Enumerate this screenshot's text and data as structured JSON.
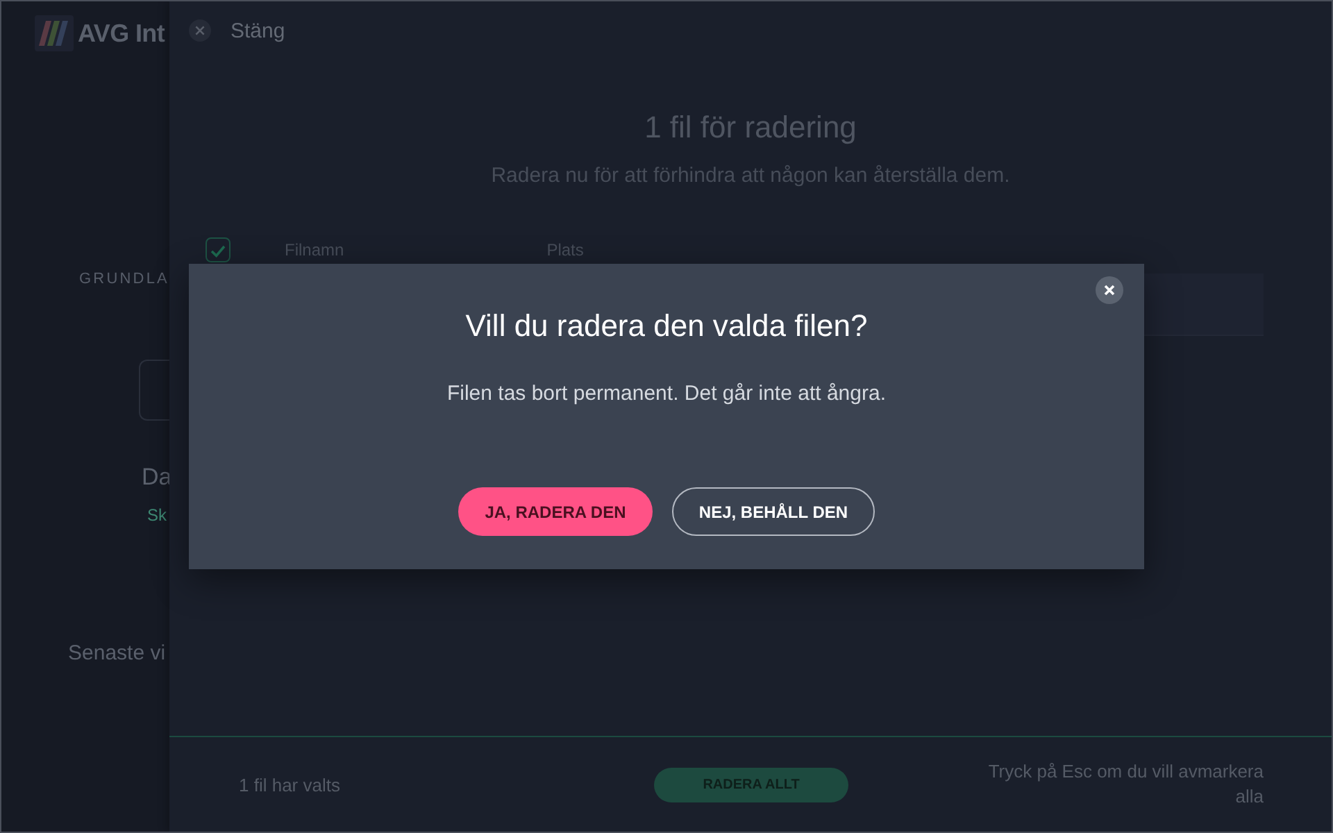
{
  "app_sidebar": {
    "logo_text": "AVG Int",
    "section_label": "GRUNDLA",
    "heading": "Da",
    "link": "Sk",
    "recent_label": "Senaste vi"
  },
  "panel": {
    "close_label": "Stäng",
    "title": "1 fil för radering",
    "subtitle": "Radera nu för att förhindra att någon kan återställa dem.",
    "table": {
      "select_all_checked": true,
      "columns": [
        "Filnamn",
        "Plats"
      ]
    }
  },
  "footer": {
    "selection_count": "1 fil har valts",
    "delete_all_button": "RADERA ALLT",
    "hint": "Tryck på Esc om du vill avmarkera alla"
  },
  "dialog": {
    "title": "Vill du radera den valda filen?",
    "message": "Filen tas bort permanent. Det går inte att ångra.",
    "buttons": [
      {
        "label": "JA, RADERA DEN",
        "kind": "primary"
      },
      {
        "label": "NEJ, BEHÅLL DEN",
        "kind": "secondary"
      }
    ]
  }
}
